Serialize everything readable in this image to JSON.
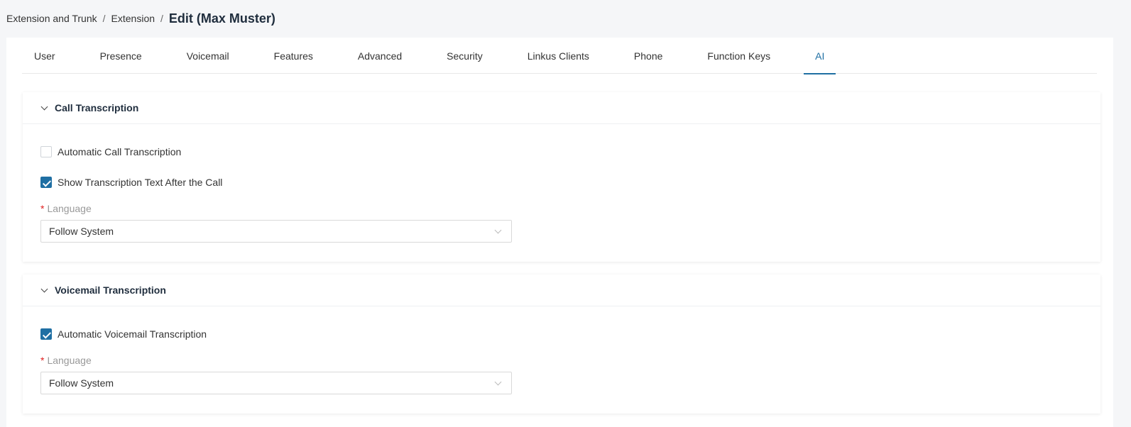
{
  "breadcrumb": {
    "items": [
      "Extension and Trunk",
      "Extension"
    ],
    "separator": "/",
    "current": "Edit (Max Muster)"
  },
  "tabs": [
    {
      "label": "User",
      "active": false
    },
    {
      "label": "Presence",
      "active": false
    },
    {
      "label": "Voicemail",
      "active": false
    },
    {
      "label": "Features",
      "active": false
    },
    {
      "label": "Advanced",
      "active": false
    },
    {
      "label": "Security",
      "active": false
    },
    {
      "label": "Linkus Clients",
      "active": false
    },
    {
      "label": "Phone",
      "active": false
    },
    {
      "label": "Function Keys",
      "active": false
    },
    {
      "label": "AI",
      "active": true
    }
  ],
  "call_transcription": {
    "title": "Call Transcription",
    "auto_label": "Automatic Call Transcription",
    "auto_checked": false,
    "show_text_label": "Show Transcription Text After the Call",
    "show_text_checked": true,
    "language_label": "Language",
    "language_value": "Follow System"
  },
  "voicemail_transcription": {
    "title": "Voicemail Transcription",
    "auto_label": "Automatic Voicemail Transcription",
    "auto_checked": true,
    "language_label": "Language",
    "language_value": "Follow System"
  },
  "required_marker": "*",
  "colors": {
    "accent": "#1f6fa3",
    "required": "#e02020",
    "background": "#f5f6f8"
  }
}
